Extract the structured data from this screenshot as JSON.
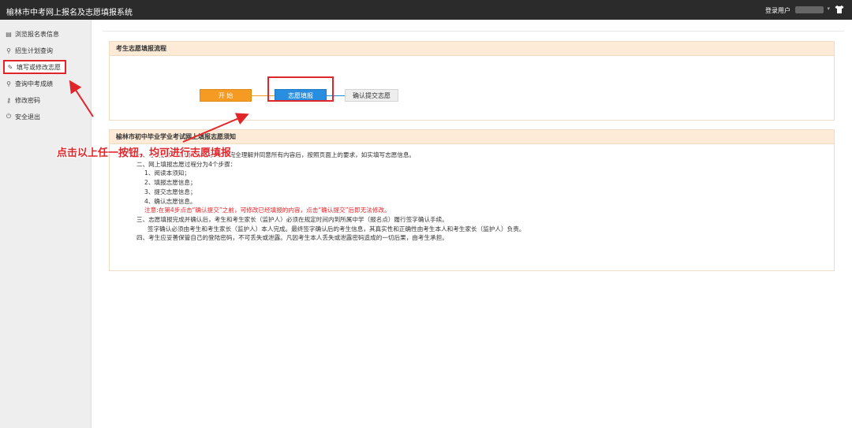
{
  "header": {
    "title": "榆林市中考网上报名及志愿填报系统",
    "user_label": "登录用户",
    "shirt_icon": "shirt-icon"
  },
  "sidebar": {
    "items": [
      {
        "label": "浏览报名表信息",
        "icon": "form-icon",
        "glyph": "▤"
      },
      {
        "label": "招生计划查询",
        "icon": "search-icon",
        "glyph": "⚲"
      },
      {
        "label": "填写或修改志愿",
        "icon": "pencil-icon",
        "glyph": "✎",
        "active": true
      },
      {
        "label": "查询中考成绩",
        "icon": "search-icon",
        "glyph": "⚲"
      },
      {
        "label": "修改密码",
        "icon": "key-icon",
        "glyph": "⚷"
      },
      {
        "label": "安全退出",
        "icon": "power-icon",
        "glyph": "⏻"
      }
    ]
  },
  "process_panel": {
    "title": "考生志愿填报流程",
    "start_label": "开 始",
    "fill_label": "志愿填报",
    "confirm_label": "确认提交志愿"
  },
  "notice_panel": {
    "title": "榆林市初中毕业学业考试网上填报志愿须知",
    "lines": [
      {
        "text": "一、考生必须认真阅读本《须知》，完全理解并同意所有内容后，按照页面上的要求，如实填写志愿信息。",
        "indent": 26,
        "red": false
      },
      {
        "text": "二、网上填报志愿过程分为4个步骤：",
        "indent": 26,
        "red": false
      },
      {
        "text": "1、阅读本须知；",
        "indent": 36,
        "red": false
      },
      {
        "text": "2、填报志愿信息；",
        "indent": 36,
        "red": false
      },
      {
        "text": "3、提交志愿信息；",
        "indent": 36,
        "red": false
      },
      {
        "text": "4、确认志愿信息。",
        "indent": 36,
        "red": false
      },
      {
        "text": "注意:在第4步点击“确认提交”之前，可修改已经填报的内容，点击“确认提交”后即无法修改。",
        "indent": 36,
        "red": true
      },
      {
        "text": "三、志愿填报完成并确认后，考生和考生家长（监护人）必须在规定时间内到所属中学（报名点）履行签字确认手续。",
        "indent": 26,
        "red": false
      },
      {
        "text": "签字确认必须由考生和考生家长（监护人）本人完成。最终签字确认后的考生信息，其真实性和正确性由考生本人和考生家长（监护人）负责。",
        "indent": 40,
        "red": false
      },
      {
        "text": "四、考生应妥善保管自己的登陆密码，不可丢失或泄露。凡因考生本人丢失或泄露密码造成的一切后果，由考生承担。",
        "indent": 26,
        "red": false
      }
    ]
  },
  "annotation": {
    "text": "点击以上任一按钮，均可进行志愿填报",
    "color": "#e0262a"
  }
}
